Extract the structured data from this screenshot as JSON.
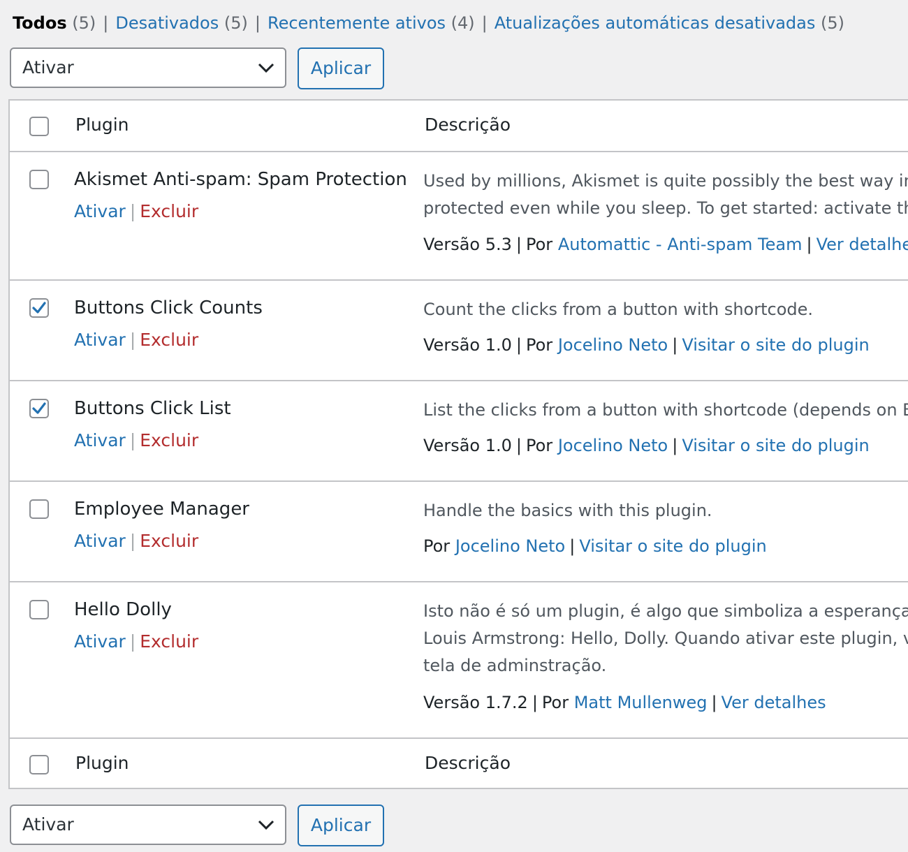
{
  "filters": [
    {
      "label": "Todos",
      "count": "(5)",
      "current": true
    },
    {
      "label": "Desativados",
      "count": "(5)"
    },
    {
      "label": "Recentemente ativos",
      "count": "(4)"
    },
    {
      "label": "Atualizações automáticas desativadas",
      "count": "(5)"
    }
  ],
  "bulk_actions": {
    "selected": "Ativar",
    "apply_label": "Aplicar"
  },
  "table": {
    "col_plugin": "Plugin",
    "col_description": "Descrição",
    "actions": {
      "activate": "Ativar",
      "delete": "Excluir"
    },
    "version_prefix": "Versão",
    "by_label": "Por",
    "rows": [
      {
        "name": "Akismet Anti-spam: Spam Protection",
        "checked": false,
        "description": [
          "Used by millions, Akismet is quite possibly the best way in the",
          "protected even while you sleep. To get started: activate the A"
        ],
        "version": "5.3",
        "author": "Automattic - Anti-spam Team",
        "details": "Ver detalhes"
      },
      {
        "name": "Buttons Click Counts",
        "checked": true,
        "description": [
          "Count the clicks from a button with shortcode."
        ],
        "version": "1.0",
        "author": "Jocelino Neto",
        "details": "Visitar o site do plugin"
      },
      {
        "name": "Buttons Click List",
        "checked": true,
        "description": [
          "List the clicks from a button with shortcode (depends on Butt"
        ],
        "version": "1.0",
        "author": "Jocelino Neto",
        "details": "Visitar o site do plugin"
      },
      {
        "name": "Employee Manager",
        "checked": false,
        "description": [
          "Handle the basics with this plugin."
        ],
        "version": "",
        "author": "Jocelino Neto",
        "details": "Visitar o site do plugin"
      },
      {
        "name": "Hello Dolly",
        "checked": false,
        "description": [
          "Isto não é só um plugin, é algo que simboliza a esperança e o",
          "Louis Armstrong: Hello, Dolly. Quando ativar este plugin, voc",
          "tela de adminstração."
        ],
        "version": "1.7.2",
        "author": "Matt Mullenweg",
        "details": "Ver detalhes"
      }
    ]
  },
  "colors": {
    "link": "#2271b1",
    "delete": "#b32d2e",
    "background": "#f0f0f1",
    "border": "#c3c4c7"
  },
  "icons": {
    "select": "chevron-down-icon",
    "checkbox": "checkmark-icon"
  }
}
